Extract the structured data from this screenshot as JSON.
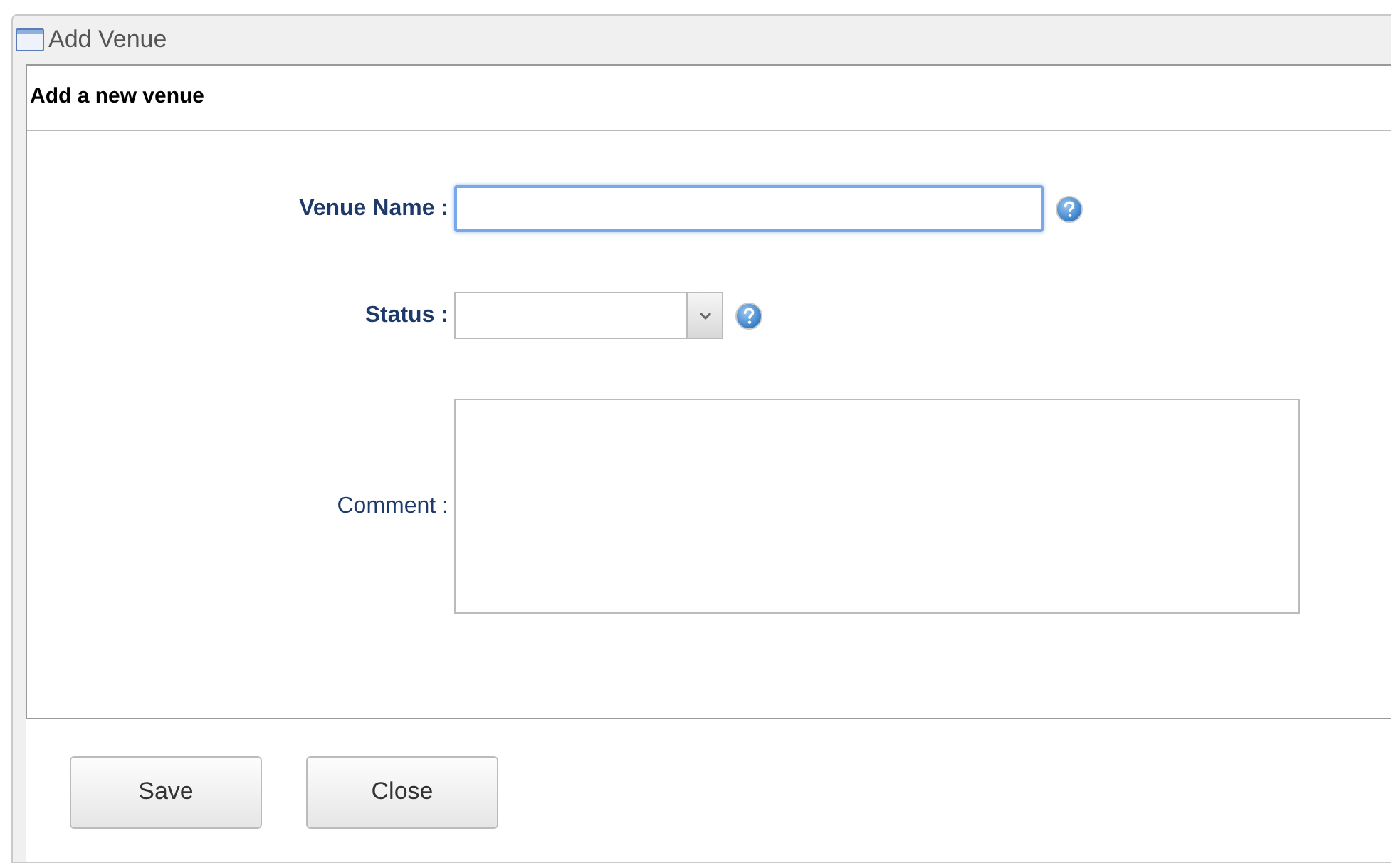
{
  "window": {
    "title": "Add Venue"
  },
  "panel": {
    "heading": "Add a new venue"
  },
  "fields": [
    {
      "kind": "text",
      "label": "Venue Name :",
      "required": true,
      "focused": true,
      "help": true
    },
    {
      "kind": "select",
      "label": "Status :",
      "required": true,
      "focused": false,
      "help": true
    },
    {
      "kind": "textarea",
      "label": "Comment :",
      "required": false,
      "focused": false,
      "help": false
    }
  ],
  "buttons": [
    "Save",
    "Close"
  ]
}
